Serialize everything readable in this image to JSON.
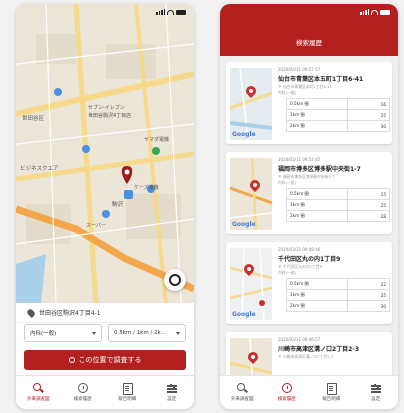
{
  "colors": {
    "brand": "#b3201f",
    "map_bg": "#ece6d8",
    "road_orange": "#f3a64a",
    "road_yellow": "#f6d98a",
    "water": "#a9cfe9"
  },
  "left": {
    "map_labels": [
      "世田谷区",
      "セブン-イレブン",
      "世田谷駒沢4丁目店",
      "ビジネスクエア",
      "ヤマダ電機",
      "ケーズ電機",
      "駒沢",
      "スーパー"
    ],
    "address": "世田谷区駒沢4丁目4-1",
    "select_area": "内科(一般)",
    "select_distance": "0.5km / 1km / 2k...",
    "search_button": "この位置で調査する"
  },
  "tabs": [
    {
      "label": "外来調査図",
      "icon": "search-icon"
    },
    {
      "label": "検索履歴",
      "icon": "clock-icon"
    },
    {
      "label": "報告明細",
      "icon": "document-icon"
    },
    {
      "label": "設定",
      "icon": "sliders-icon"
    }
  ],
  "right": {
    "header_title": "検索履歴",
    "cards": [
      {
        "date": "2020/03/31 09:57:57",
        "address": "仙台市青葉区本五町1丁目6-41",
        "sub": "〒 仙台市青葉区本町1丁目6-41",
        "sub2": "内科(一般)",
        "rows": [
          {
            "label": "0.5km 圏",
            "value": "16"
          },
          {
            "label": "1km 圏",
            "value": "25"
          },
          {
            "label": "2km 圏",
            "value": "30"
          }
        ]
      },
      {
        "date": "2020/03/31 09:54:45",
        "address": "福岡市博多区博多駅中央街1-7",
        "sub": "〒 福岡市博多区博多駅中央街1-7",
        "sub2": "内科(一般)",
        "rows": [
          {
            "label": "0.5km 圏",
            "value": "15"
          },
          {
            "label": "1km 圏",
            "value": "25"
          },
          {
            "label": "2km 圏",
            "value": "28"
          }
        ]
      },
      {
        "date": "2020/03/31 09:48:46",
        "address": "千代田区丸の内1丁目9",
        "sub": "〒 千代田区丸の内1丁目9",
        "sub2": "内科(一般)",
        "rows": [
          {
            "label": "0.5km 圏",
            "value": "22"
          },
          {
            "label": "1km 圏",
            "value": "25"
          },
          {
            "label": "2km 圏",
            "value": "30"
          }
        ]
      },
      {
        "date": "2020/03/31 09:46:57",
        "address": "川崎市高津区溝ノ口2丁目2-3",
        "sub": "〒 川崎市高津区溝ノ口2丁目2-3",
        "sub2": "",
        "rows": []
      }
    ],
    "google_label": "Google"
  }
}
